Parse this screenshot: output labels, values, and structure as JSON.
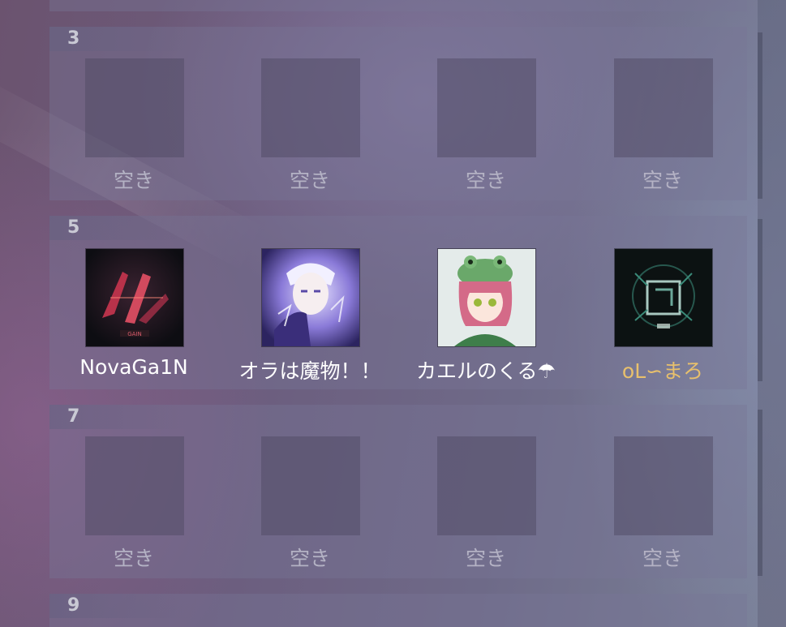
{
  "rows": [
    {
      "number": "3",
      "slots": [
        {
          "label": "空き",
          "type": "empty"
        },
        {
          "label": "空き",
          "type": "empty"
        },
        {
          "label": "空き",
          "type": "empty"
        },
        {
          "label": "空き",
          "type": "empty"
        }
      ]
    },
    {
      "number": "5",
      "slots": [
        {
          "label": "NovaGa1N",
          "type": "player",
          "avatar": "novagain-avatar"
        },
        {
          "label": "オラは魔物！！",
          "type": "player",
          "avatar": "anime-boy-avatar"
        },
        {
          "label": "カエルのくる☂",
          "type": "player",
          "avatar": "frog-hat-girl-avatar"
        },
        {
          "label": "oL∽まろ",
          "type": "player",
          "avatar": "dark-logo-avatar",
          "highlight_color": "#e8c06c"
        }
      ]
    },
    {
      "number": "7",
      "slots": [
        {
          "label": "空き",
          "type": "empty"
        },
        {
          "label": "空き",
          "type": "empty"
        },
        {
          "label": "空き",
          "type": "empty"
        },
        {
          "label": "空き",
          "type": "empty"
        }
      ]
    },
    {
      "number": "9",
      "slots": []
    }
  ]
}
